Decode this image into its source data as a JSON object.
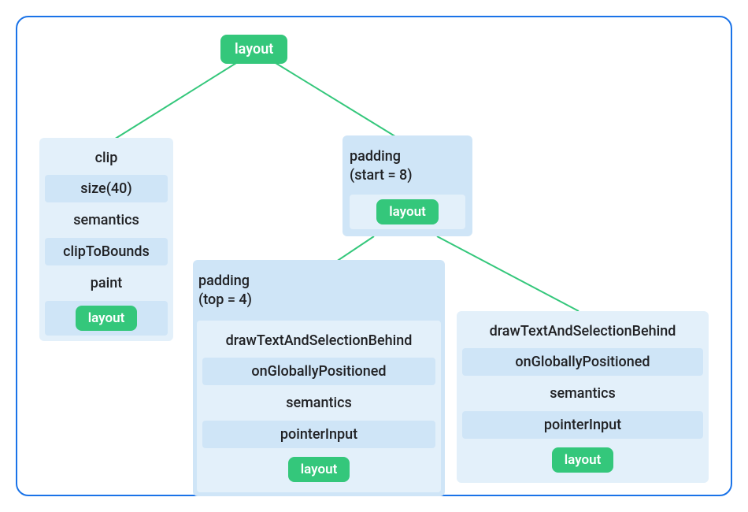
{
  "root": {
    "label": "layout"
  },
  "left": {
    "rows": [
      "clip",
      "size(40)",
      "semantics",
      "clipToBounds",
      "paint"
    ],
    "layout": "layout"
  },
  "right": {
    "padding_line1": "padding",
    "padding_line2": "(start = 8)",
    "layout": "layout"
  },
  "bottom_left": {
    "padding_line1": "padding",
    "padding_line2": "(top = 4)",
    "rows": [
      "drawTextAndSelectionBehind",
      "onGloballyPositioned",
      "semantics",
      "pointerInput"
    ],
    "layout": "layout"
  },
  "bottom_right": {
    "rows": [
      "drawTextAndSelectionBehind",
      "onGloballyPositioned",
      "semantics",
      "pointerInput"
    ],
    "layout": "layout"
  }
}
